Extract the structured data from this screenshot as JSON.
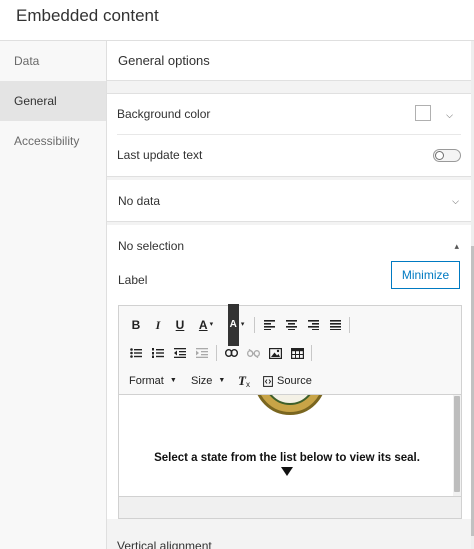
{
  "window": {
    "title": "Embedded content"
  },
  "sidebar": {
    "items": [
      {
        "label": "Data",
        "active": false
      },
      {
        "label": "General",
        "active": true
      },
      {
        "label": "Accessibility",
        "active": false
      }
    ]
  },
  "panel": {
    "title": "General options",
    "background_color": {
      "label": "Background color",
      "value": "#ffffff"
    },
    "last_update_text": {
      "label": "Last update text",
      "enabled": false
    },
    "no_data": {
      "label": "No data",
      "expanded": false
    },
    "no_selection": {
      "label": "No selection",
      "expanded": true,
      "label_field": "Label",
      "minimize_label": "Minimize",
      "editor": {
        "format_label": "Format",
        "size_label": "Size",
        "source_label": "Source",
        "body_text": "Select a state from the list below to view its seal."
      }
    },
    "next_field": "Vertical alignment"
  },
  "colors": {
    "accent": "#007ac2",
    "nav_active_bg": "#e4e4e4",
    "panel_bg": "#f3f3f3"
  }
}
